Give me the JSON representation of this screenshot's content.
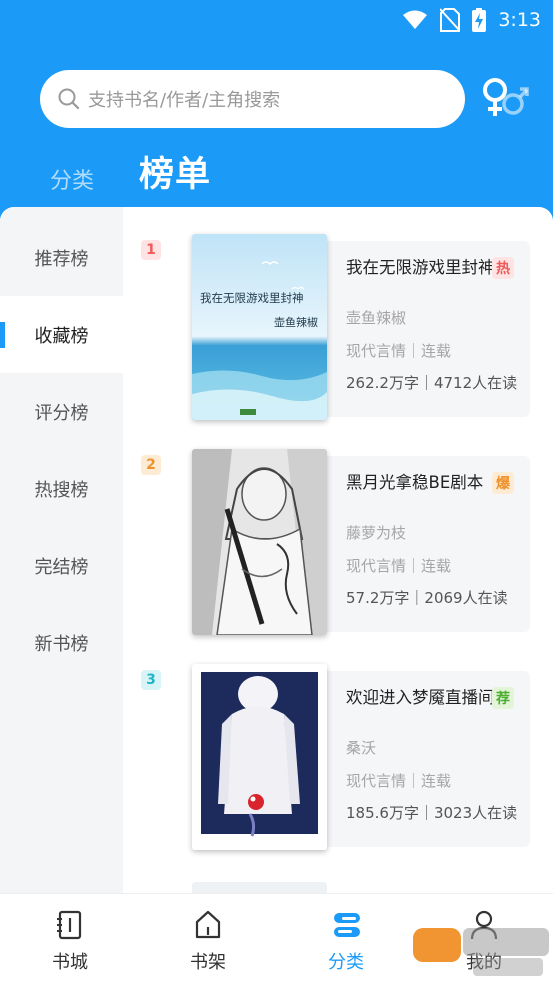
{
  "status_bar": {
    "time": "3:13"
  },
  "search": {
    "placeholder": "支持书名/作者/主角搜索"
  },
  "top_tabs": {
    "category": "分类",
    "ranking": "榜单"
  },
  "sidebar": {
    "items": [
      {
        "label": "推荐榜",
        "active": false
      },
      {
        "label": "收藏榜",
        "active": true
      },
      {
        "label": "评分榜",
        "active": false
      },
      {
        "label": "热搜榜",
        "active": false
      },
      {
        "label": "完结榜",
        "active": false
      },
      {
        "label": "新书榜",
        "active": false
      }
    ]
  },
  "books": [
    {
      "rank": "1",
      "rank_color": "#f05a5a",
      "rank_bg": "#fde3e3",
      "title": "我在无限游戏里封神",
      "tag": "热",
      "tag_color": "#f05a5a",
      "tag_bg": "#fde3e3",
      "author": "壶鱼辣椒",
      "genre": "现代言情｜连载",
      "stats": "262.2万字｜4712人在读",
      "cover_title": "我在无限游戏里封神",
      "cover_author": "壶鱼辣椒"
    },
    {
      "rank": "2",
      "rank_color": "#f0922b",
      "rank_bg": "#fdebd3",
      "title": "黑月光拿稳BE剧本",
      "tag": "爆",
      "tag_color": "#f0922b",
      "tag_bg": "#fdebd3",
      "author": "藤萝为枝",
      "genre": "现代言情｜连载",
      "stats": "57.2万字｜2069人在读"
    },
    {
      "rank": "3",
      "rank_color": "#1fb6c9",
      "rank_bg": "#d8f4f7",
      "title": "欢迎进入梦魇直播间",
      "tag": "荐",
      "tag_color": "#4cae30",
      "tag_bg": "#e3f4d9",
      "author": "桑沃",
      "genre": "现代言情｜连载",
      "stats": "185.6万字｜3023人在读"
    }
  ],
  "bottom_nav": {
    "items": [
      {
        "label": "书城",
        "icon": "book-city-icon"
      },
      {
        "label": "书架",
        "icon": "bookshelf-icon"
      },
      {
        "label": "分类",
        "icon": "category-icon",
        "active": true
      },
      {
        "label": "我的",
        "icon": "profile-icon"
      }
    ]
  },
  "colors": {
    "accent": "#1b9bf7"
  }
}
